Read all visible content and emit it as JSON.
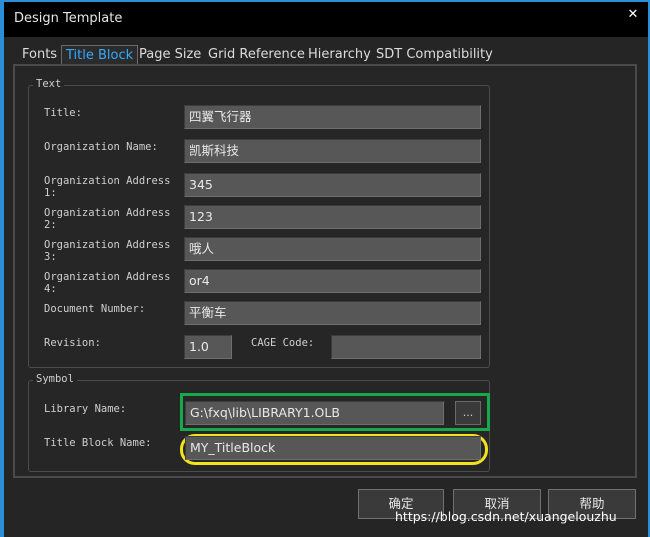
{
  "window": {
    "title": "Design Template",
    "close_glyph": "✕"
  },
  "tabs": [
    {
      "label": "Fonts",
      "active": false
    },
    {
      "label": "Title Block",
      "active": true
    },
    {
      "label": "Page Size",
      "active": false
    },
    {
      "label": "Grid Reference",
      "active": false
    },
    {
      "label": "Hierarchy",
      "active": false
    },
    {
      "label": "SDT Compatibility",
      "active": false
    }
  ],
  "text_group": {
    "legend": "Text",
    "fields": [
      {
        "label": "Title:",
        "value": "四翼飞行器"
      },
      {
        "label": "Organization Name:",
        "value": "凯斯科技"
      },
      {
        "label": "Organization Address\n1:",
        "value": "345"
      },
      {
        "label": "Organization Address\n2:",
        "value": "123"
      },
      {
        "label": "Organization Address\n3:",
        "value": "哦人"
      },
      {
        "label": "Organization Address\n4:",
        "value": "or4"
      },
      {
        "label": "Document Number:",
        "value": "平衡车"
      }
    ],
    "revision": {
      "label": "Revision:",
      "value": "1.0"
    },
    "cage_code": {
      "label": "CAGE Code:",
      "value": ""
    }
  },
  "symbol_group": {
    "legend": "Symbol",
    "library_name": {
      "label": "Library Name:",
      "value": "G:\\fxq\\lib\\LIBRARY1.OLB",
      "browse_label": "..."
    },
    "title_block_name": {
      "label": "Title Block Name:",
      "value": "MY_TitleBlock"
    }
  },
  "highlight_colors": {
    "library_name": "#16a84a",
    "title_block_name": "#f3e21e"
  },
  "buttons": {
    "ok": "确定",
    "cancel": "取消",
    "help": "帮助"
  },
  "watermark": "https://blog.csdn.net/xuangelouzhu"
}
